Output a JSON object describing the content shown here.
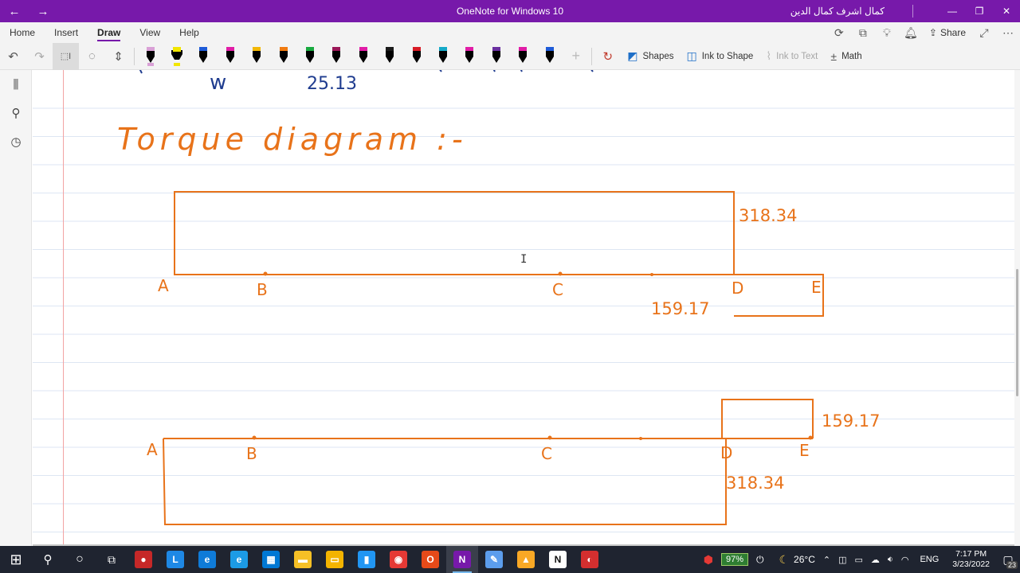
{
  "titlebar": {
    "title": "OneNote for Windows 10",
    "user": "كمال اشرف كمال الدين",
    "nav_icons": [
      "back-arrow-icon",
      "forward-arrow-icon"
    ]
  },
  "menu": {
    "items": [
      {
        "label": "Home"
      },
      {
        "label": "Insert"
      },
      {
        "label": "Draw",
        "active": true
      },
      {
        "label": "View"
      },
      {
        "label": "Help"
      }
    ],
    "share_label": "Share"
  },
  "ribbon": {
    "shapes_label": "Shapes",
    "ink_to_shape_label": "Ink to Shape",
    "ink_to_text_label": "Ink to Text",
    "math_label": "Math",
    "pens": [
      {
        "color": "#000000",
        "tip": "#d9a0d6"
      },
      {
        "color": "#000000",
        "tip": "#f2e600",
        "highlighter": true
      },
      {
        "color": "#000000",
        "tip": "#1e5bd8"
      },
      {
        "color": "#000000",
        "tip": "#e11ca6"
      },
      {
        "color": "#000000",
        "tip": "#f2b705"
      },
      {
        "color": "#000000",
        "tip": "#f07a10"
      },
      {
        "color": "#000000",
        "tip": "#18a93f"
      },
      {
        "color": "#000000",
        "tip": "#9a1657"
      },
      {
        "color": "#000000",
        "tip": "#e11ca6"
      },
      {
        "color": "#000000",
        "tip": "#1a1a1a"
      },
      {
        "color": "#000000",
        "tip": "#d81b25"
      },
      {
        "color": "#000000",
        "tip": "#15a9c8"
      },
      {
        "color": "#000000",
        "tip": "#e11ca6"
      },
      {
        "color": "#000000",
        "tip": "#6a2fa0"
      },
      {
        "color": "#000000",
        "tip": "#e11ca6"
      },
      {
        "color": "#000000",
        "tip": "#1e5bd8"
      }
    ]
  },
  "canvas": {
    "ink_color": "#e8731a",
    "blue_ink_color": "#1f3c8f",
    "top_fragment_letter": "w",
    "top_fragment_value": "25.13",
    "heading": "Torque diagram :-",
    "diagram1": {
      "points": [
        "A",
        "B",
        "C",
        "D",
        "E"
      ],
      "upper_value": "318.34",
      "lower_value": "159.17"
    },
    "diagram2": {
      "points": [
        "A",
        "B",
        "C",
        "D",
        "E"
      ],
      "upper_value": "159.17",
      "lower_value": "318.34"
    }
  },
  "taskbar": {
    "apps": [
      {
        "name": "start-icon"
      },
      {
        "name": "search-icon"
      },
      {
        "name": "cortana-icon"
      },
      {
        "name": "task-view-icon"
      },
      {
        "name": "app-red-icon",
        "color": "#c62828",
        "glyph": "●"
      },
      {
        "name": "app-l-icon",
        "color": "#1e88e5",
        "glyph": "L"
      },
      {
        "name": "edge-icon",
        "color": "#0f7bd8",
        "glyph": "e"
      },
      {
        "name": "ie-icon",
        "color": "#1c9be6",
        "glyph": "e"
      },
      {
        "name": "store-icon",
        "color": "#0078d4",
        "glyph": "▦"
      },
      {
        "name": "sticky-notes-icon",
        "color": "#f6c026",
        "glyph": "▬"
      },
      {
        "name": "file-explorer-icon",
        "color": "#f4b400",
        "glyph": "▭"
      },
      {
        "name": "phone-app-icon",
        "color": "#2196f3",
        "glyph": "▮"
      },
      {
        "name": "chrome-icon",
        "color": "#e53935",
        "glyph": "◉"
      },
      {
        "name": "office-icon",
        "color": "#e64a19",
        "glyph": "O"
      },
      {
        "name": "onenote-icon",
        "color": "#7719aa",
        "glyph": "N",
        "active": true
      },
      {
        "name": "paint-icon",
        "color": "#5c9ded",
        "glyph": "✎"
      },
      {
        "name": "app-yellow-icon",
        "color": "#f9a825",
        "glyph": "▲"
      },
      {
        "name": "notion-icon",
        "color": "#ffffff",
        "glyph": "N",
        "dark_text": true
      },
      {
        "name": "screen-recorder-icon",
        "color": "#d32f2f",
        "glyph": "◐"
      }
    ],
    "battery": "97%",
    "weather": "26°C",
    "language": "ENG",
    "time": "7:17 PM",
    "date": "3/23/2022",
    "notifications": "23"
  }
}
